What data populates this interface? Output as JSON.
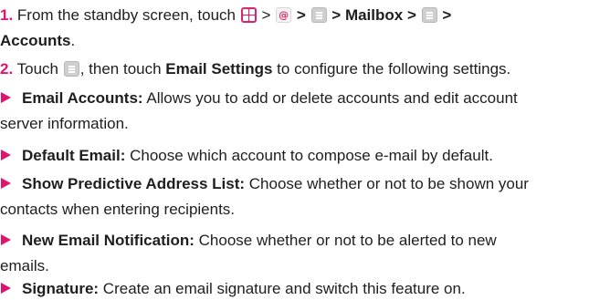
{
  "steps": [
    {
      "num": "1.",
      "pre": "From the standby screen, touch",
      "sep1": ">",
      "sep2": ">",
      "sep3": ">",
      "mailbox": "Mailbox",
      "sep4": ">",
      "sep5": ">",
      "accounts": "Accounts",
      "end": "."
    },
    {
      "num": "2.",
      "pre": "Touch",
      "mid": ", then touch",
      "bold": "Email Settings",
      "post": "to configure the following settings."
    }
  ],
  "bullets": [
    {
      "title": "Email Accounts:",
      "text": "Allows you to add or delete accounts and edit account",
      "cont": "server information."
    },
    {
      "title": "Default Email:",
      "text": "Choose which account to compose e-mail by default."
    },
    {
      "title": "Show Predictive Address List:",
      "text": "Choose whether or not to be shown your",
      "cont": "contacts when entering recipients."
    },
    {
      "title": "New Email Notification:",
      "text": "Choose whether or not to be alerted to new",
      "cont": "emails."
    },
    {
      "title": "Signature:",
      "text": "Create an email signature and switch this feature on."
    }
  ],
  "icons": {
    "apps": "apps-grid-icon",
    "email": "email-app-icon",
    "menu": "menu-icon"
  },
  "colors": {
    "accent": "#e2136e",
    "text": "#1e1e1e"
  }
}
